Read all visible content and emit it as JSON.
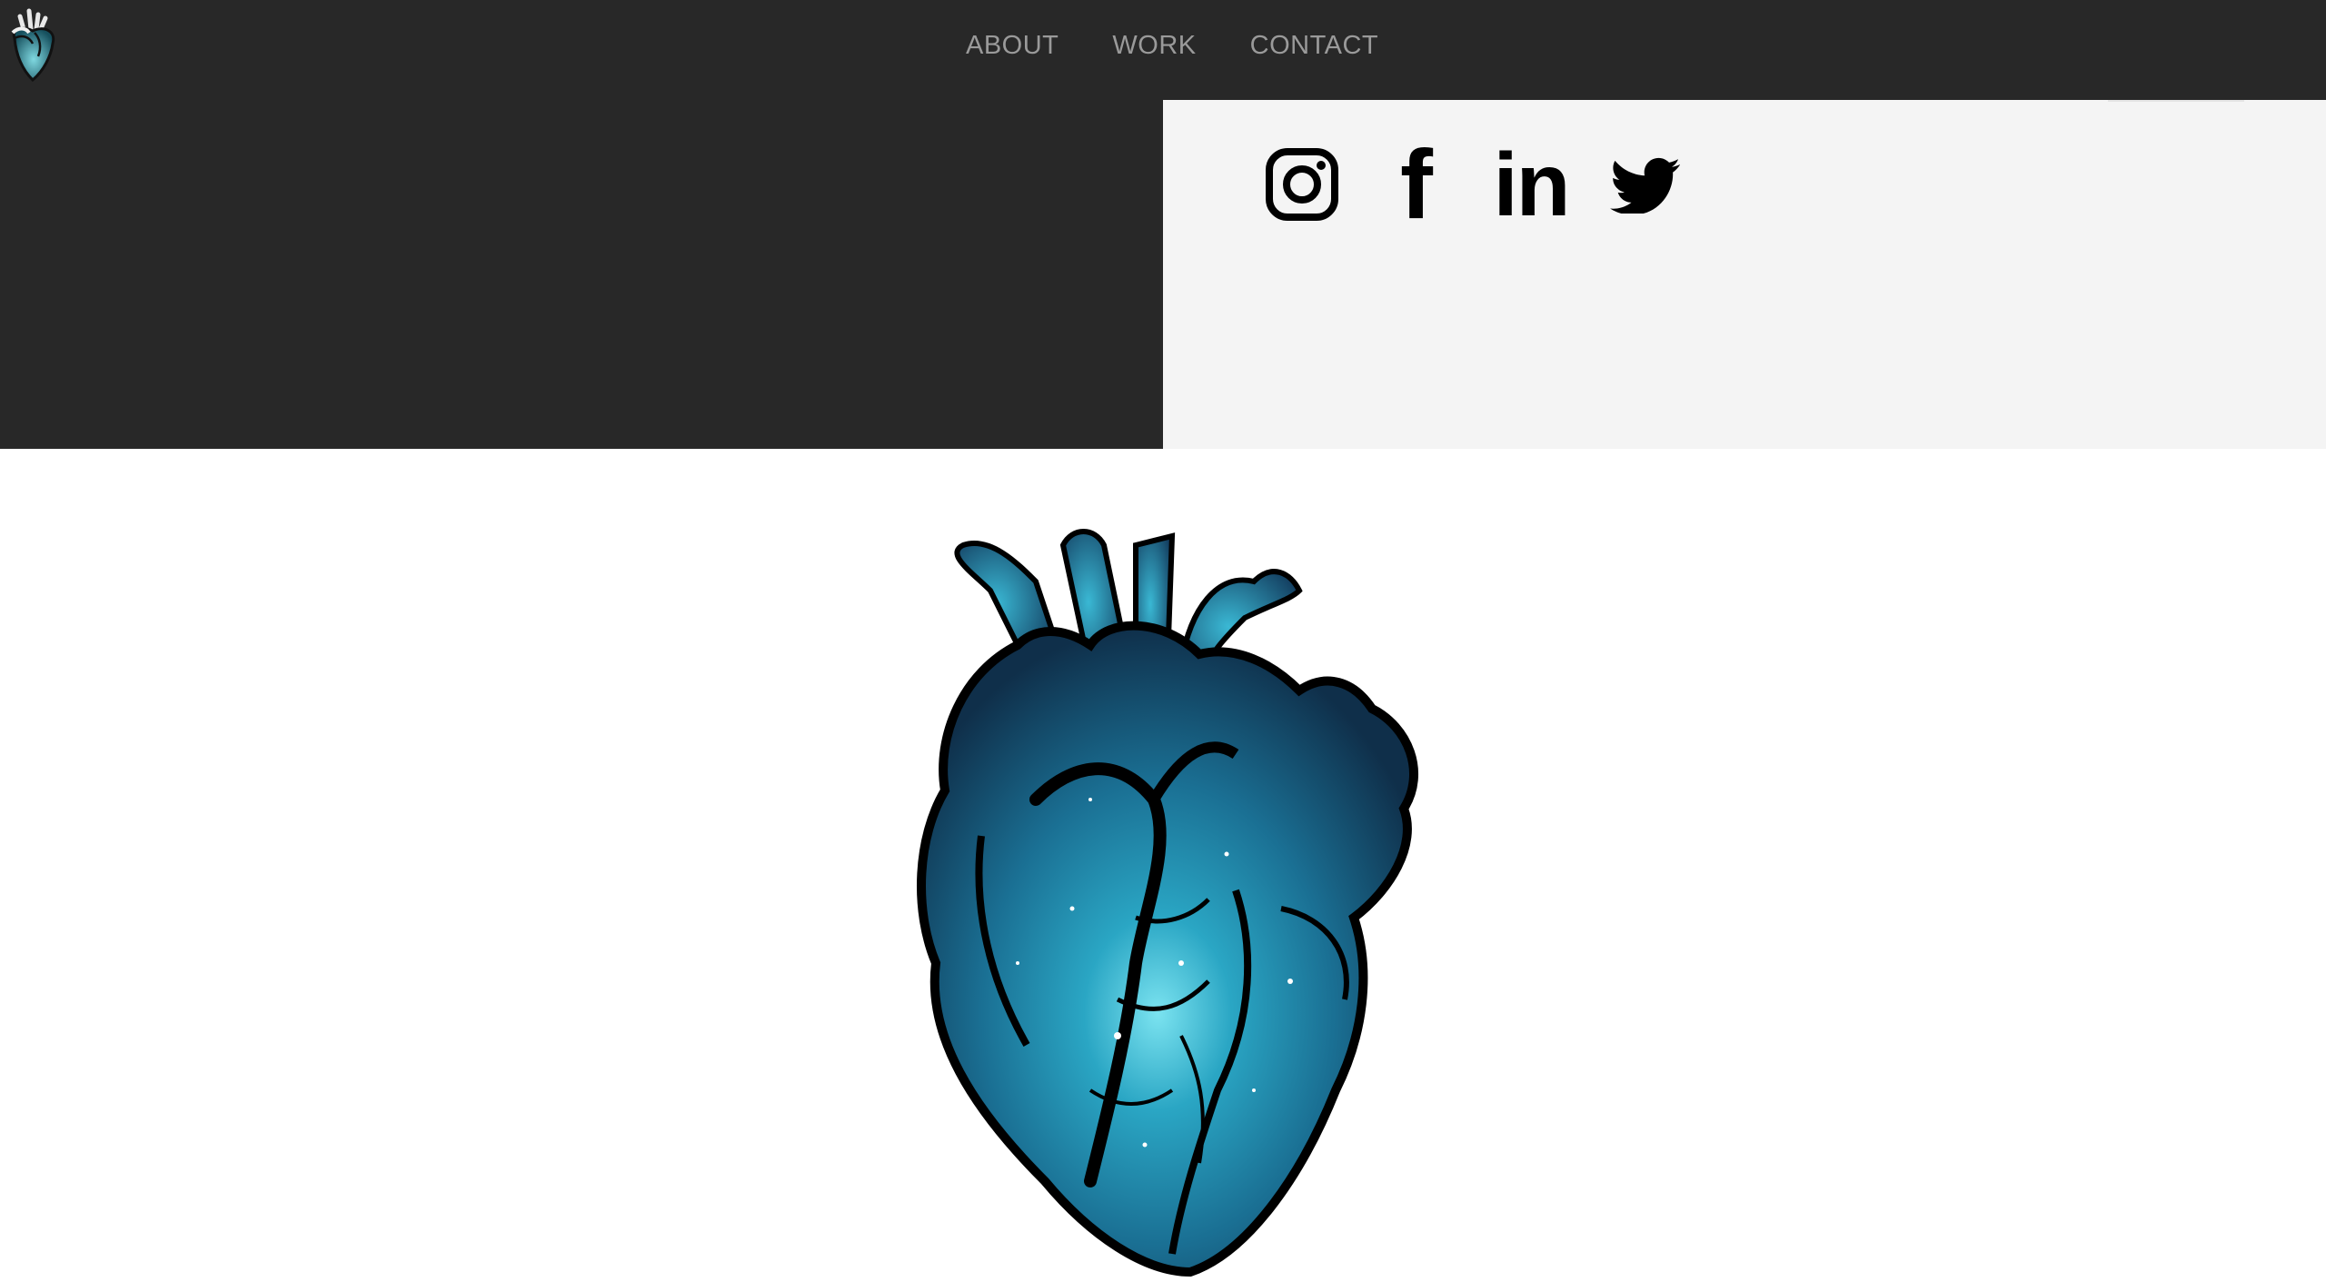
{
  "nav": {
    "links": [
      {
        "label": "ABOUT"
      },
      {
        "label": "WORK"
      },
      {
        "label": "CONTACT"
      }
    ]
  },
  "social": {
    "icons": [
      {
        "name": "instagram-icon"
      },
      {
        "name": "facebook-icon",
        "glyph": "f"
      },
      {
        "name": "linkedin-icon",
        "glyph": "in"
      },
      {
        "name": "twitter-icon"
      }
    ]
  },
  "colors": {
    "navbar_bg": "#282828",
    "light_panel_bg": "#f4f4f4",
    "nav_text": "#9a9a9a",
    "heart_accent": "#1f7fa0"
  }
}
